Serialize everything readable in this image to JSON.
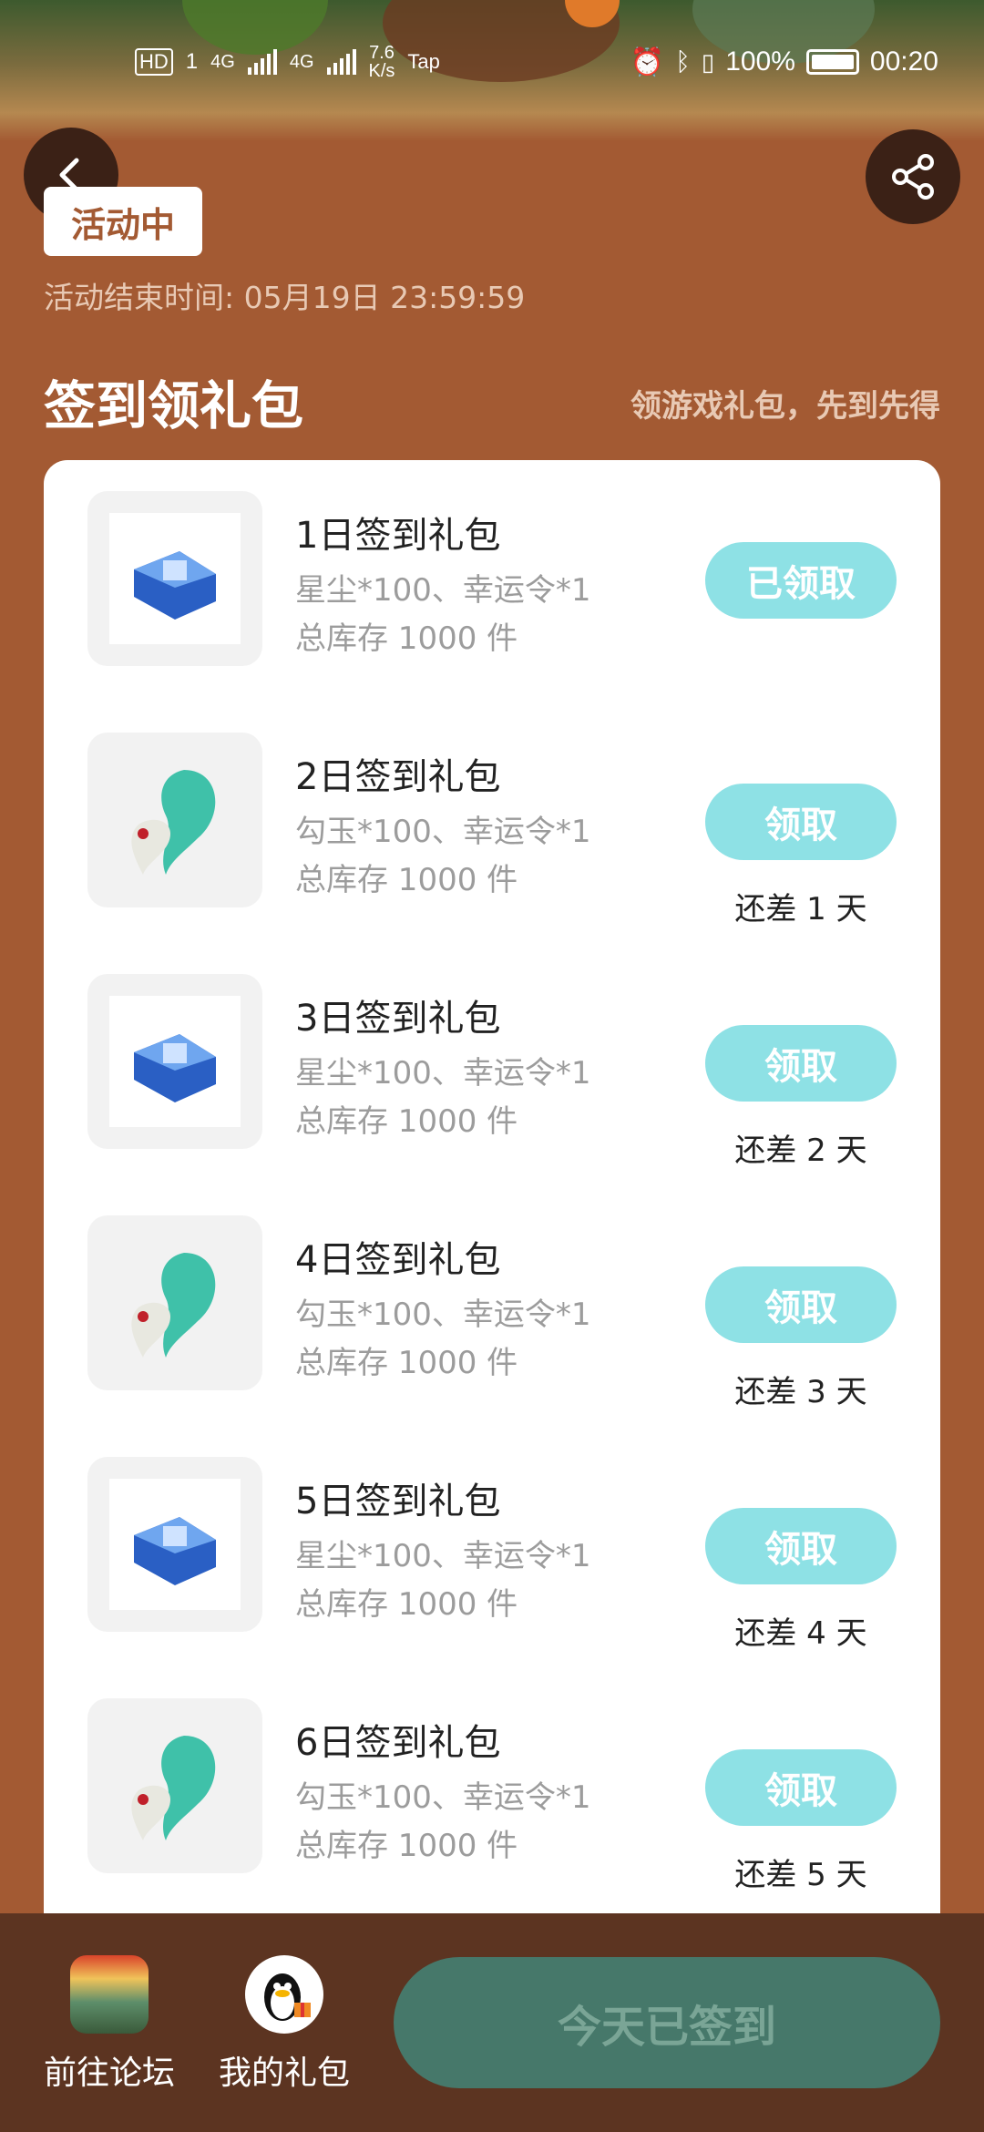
{
  "status_bar": {
    "hd": "HD",
    "sim1": "1",
    "net1": "4G",
    "net2": "4G",
    "speed_value": "7.6",
    "speed_unit": "K/s",
    "app_tag": "Tap",
    "battery": "100%",
    "time": "00:20"
  },
  "activity": {
    "status": "活动中",
    "end_time": "活动结束时间: 05月19日 23:59:59"
  },
  "section": {
    "title": "签到领礼包",
    "hint": "领游戏礼包，先到先得"
  },
  "gifts": [
    {
      "title": "1日签到礼包",
      "desc": "星尘*100、幸运令*1",
      "stock": "总库存 1000 件",
      "button": "已领取",
      "remain": "",
      "icon": "blue-chest-icon"
    },
    {
      "title": "2日签到礼包",
      "desc": "勾玉*100、幸运令*1",
      "stock": "总库存 1000 件",
      "button": "领取",
      "remain": "还差 1 天",
      "icon": "jade-magatama-icon"
    },
    {
      "title": "3日签到礼包",
      "desc": "星尘*100、幸运令*1",
      "stock": "总库存 1000 件",
      "button": "领取",
      "remain": "还差 2 天",
      "icon": "blue-chest-icon"
    },
    {
      "title": "4日签到礼包",
      "desc": "勾玉*100、幸运令*1",
      "stock": "总库存 1000 件",
      "button": "领取",
      "remain": "还差 3 天",
      "icon": "jade-magatama-icon"
    },
    {
      "title": "5日签到礼包",
      "desc": "星尘*100、幸运令*1",
      "stock": "总库存 1000 件",
      "button": "领取",
      "remain": "还差 4 天",
      "icon": "blue-chest-icon"
    },
    {
      "title": "6日签到礼包",
      "desc": "勾玉*100、幸运令*1",
      "stock": "总库存 1000 件",
      "button": "领取",
      "remain": "还差 5 天",
      "icon": "jade-magatama-icon"
    }
  ],
  "bottom": {
    "forum": "前往论坛",
    "my_gifts": "我的礼包",
    "signed": "今天已签到"
  },
  "colors": {
    "background": "#a35a33",
    "claim_button": "#8ee1e5",
    "bottom_bar": "#5c3421",
    "signed_button": "#46786a"
  }
}
